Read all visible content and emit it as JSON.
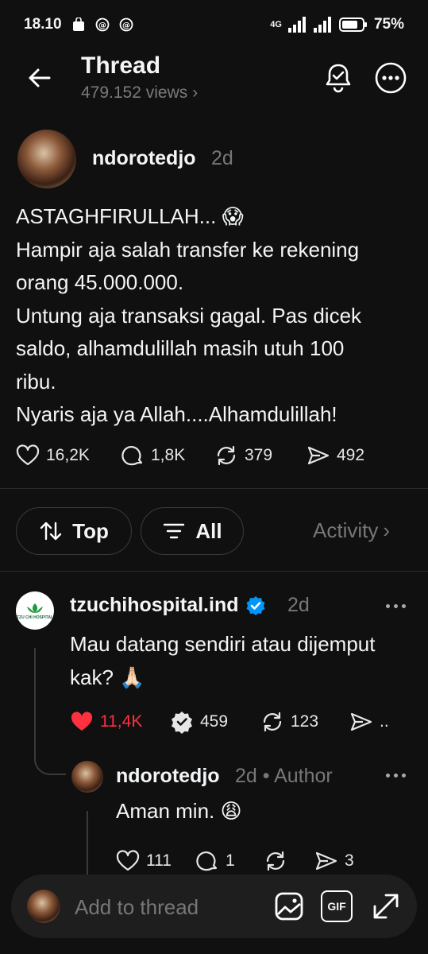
{
  "status": {
    "time": "18.10",
    "network": "4G",
    "battery": "75%"
  },
  "header": {
    "title": "Thread",
    "views": "479.152 views",
    "views_chevron": "›"
  },
  "post": {
    "author": "ndorotedjo",
    "time": "2d",
    "lines": [
      "ASTAGHFIRULLAH... 😱",
      "Hampir aja salah transfer ke rekening",
      "orang 45.000.000.",
      "Untung aja transaksi gagal. Pas dicek",
      "saldo, alhamdulillah masih utuh 100",
      "ribu.",
      "Nyaris aja ya Allah....Alhamdulillah!"
    ],
    "likes": "16,2K",
    "comments": "1,8K",
    "reposts": "379",
    "shares": "492"
  },
  "filters": {
    "sort_label": "Top",
    "scope_label": "All",
    "activity_label": "Activity",
    "activity_chevron": "›"
  },
  "reply1": {
    "author": "tzuchihospital.ind",
    "time": "2d",
    "avatar_text": "TZU CHI HOSPITAL",
    "lines": [
      "Mau datang sendiri atau dijemput",
      "kak? 🙏🏻"
    ],
    "likes": "11,4K",
    "comments": "459",
    "reposts": "123",
    "shares": ".."
  },
  "reply2": {
    "author": "ndorotedjo",
    "meta": "2d • Author",
    "text": "Aman min. 😩",
    "likes": "111",
    "comments": "1",
    "reposts": "",
    "shares": "3"
  },
  "composer": {
    "placeholder": "Add to thread",
    "gif_label": "GIF"
  },
  "colors": {
    "background": "#101010",
    "text": "#f3f5f7",
    "muted": "#777777",
    "like_red": "#ff3040",
    "verified_blue": "#0095f6"
  }
}
